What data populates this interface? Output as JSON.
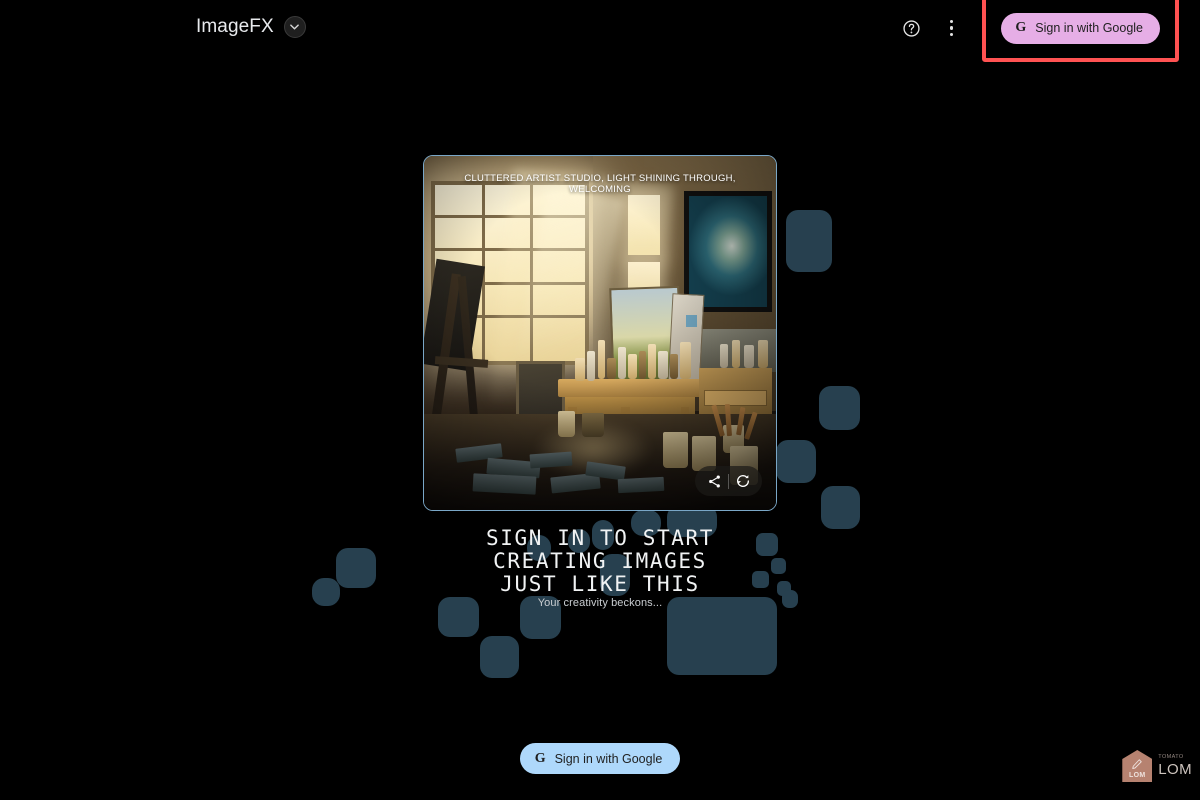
{
  "app": {
    "brand_title": "ImageFX",
    "background_color": "#000000"
  },
  "topbar": {
    "model_chevron_icon": "chevron-down-icon",
    "help_icon": "help-circle-icon",
    "overflow_icon": "more-vertical-icon",
    "signin_label": "Sign in with Google",
    "google_logo_glyph": "G",
    "highlight_color": "#ff5252",
    "signin_button_color": "#e6aee6"
  },
  "image_card": {
    "caption": "CLUTTERED ARTIST STUDIO, LIGHT SHINING THROUGH, WELCOMING",
    "border_color": "#7aa7c7",
    "actions": [
      {
        "name": "share-icon",
        "label": "Share"
      },
      {
        "name": "regenerate-icon",
        "label": "Regenerate"
      }
    ]
  },
  "hero": {
    "headline": "SIGN IN TO START\nCREATING IMAGES\nJUST LIKE THIS",
    "subheadline": "Your creativity beckons...",
    "signin_label": "Sign in with Google",
    "google_logo_glyph": "G",
    "signin_button_color": "#aed8fb"
  },
  "watermark": {
    "badge_text": "LOM",
    "top_text": "TOMATO",
    "main_text": "LOM",
    "badge_color": "#c08a76"
  },
  "decor": {
    "square_color": "#27404f"
  }
}
